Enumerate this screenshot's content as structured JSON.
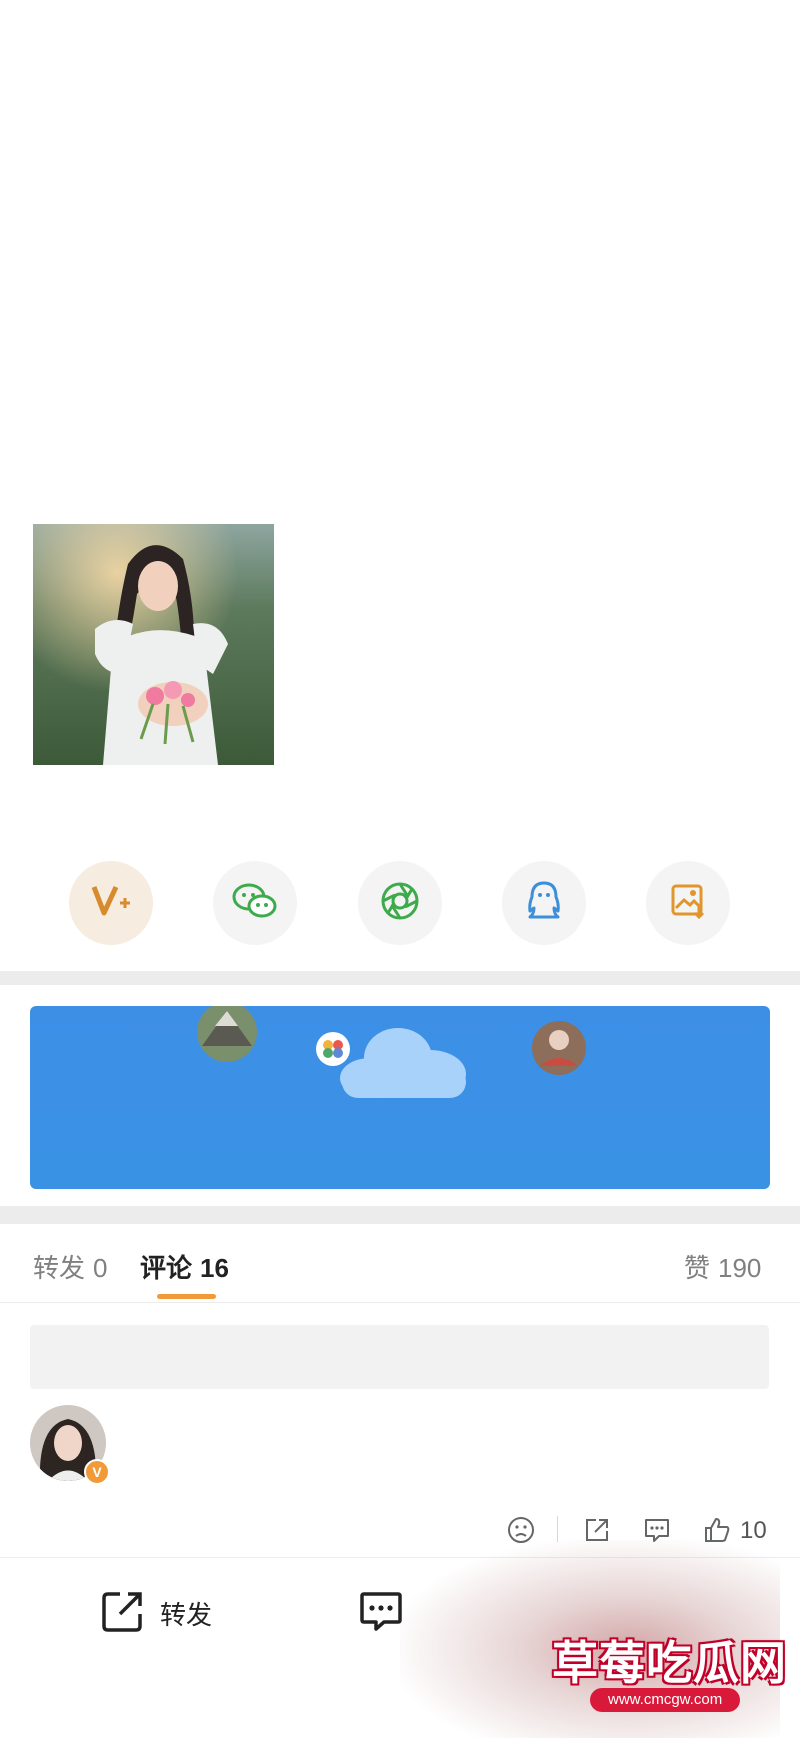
{
  "share": {
    "icons": [
      "vip-forward-icon",
      "wechat-icon",
      "moments-icon",
      "qq-icon",
      "save-image-icon"
    ]
  },
  "tabs": {
    "repost": {
      "label": "转发",
      "count": "0"
    },
    "comments": {
      "label": "评论",
      "count": "16"
    },
    "likes": {
      "label": "赞",
      "count": "190"
    }
  },
  "comment": {
    "badge": "V",
    "like_count": "10"
  },
  "bottom_bar": {
    "repost_label": "转发"
  },
  "watermark": {
    "title": "草莓吃瓜网",
    "url": "www.cmcgw.com"
  },
  "colors": {
    "accent": "#f19a38",
    "banner_blue": "#3d8fe6",
    "divider": "#ececec"
  }
}
